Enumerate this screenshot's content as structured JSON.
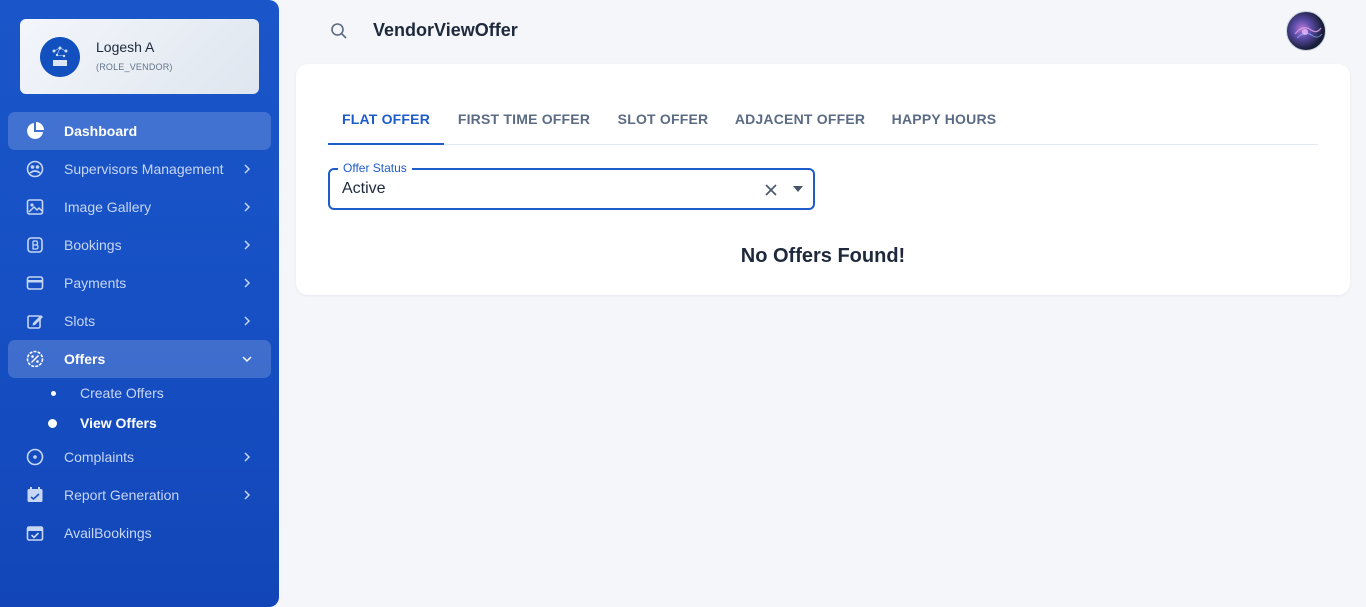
{
  "profile": {
    "name": "Logesh A",
    "role": "(ROLE_VENDOR)"
  },
  "sidebar": {
    "items": [
      {
        "label": "Dashboard"
      },
      {
        "label": "Supervisors Management"
      },
      {
        "label": "Image Gallery"
      },
      {
        "label": "Bookings"
      },
      {
        "label": "Payments"
      },
      {
        "label": "Slots"
      },
      {
        "label": "Offers"
      },
      {
        "label": "Complaints"
      },
      {
        "label": "Report Generation"
      },
      {
        "label": "AvailBookings"
      }
    ],
    "offers_sub": [
      {
        "label": "Create Offers"
      },
      {
        "label": "View Offers"
      }
    ]
  },
  "header": {
    "title": "VendorViewOffer"
  },
  "tabs": [
    {
      "label": "FLAT OFFER"
    },
    {
      "label": "FIRST TIME OFFER"
    },
    {
      "label": "SLOT OFFER"
    },
    {
      "label": "ADJACENT OFFER"
    },
    {
      "label": "HAPPY HOURS"
    }
  ],
  "filter": {
    "label": "Offer Status",
    "value": "Active"
  },
  "empty_message": "No Offers Found!",
  "colors": {
    "sidebar": "#1a56c9",
    "accent": "#1e5ccc",
    "background": "#f4f6fa"
  }
}
